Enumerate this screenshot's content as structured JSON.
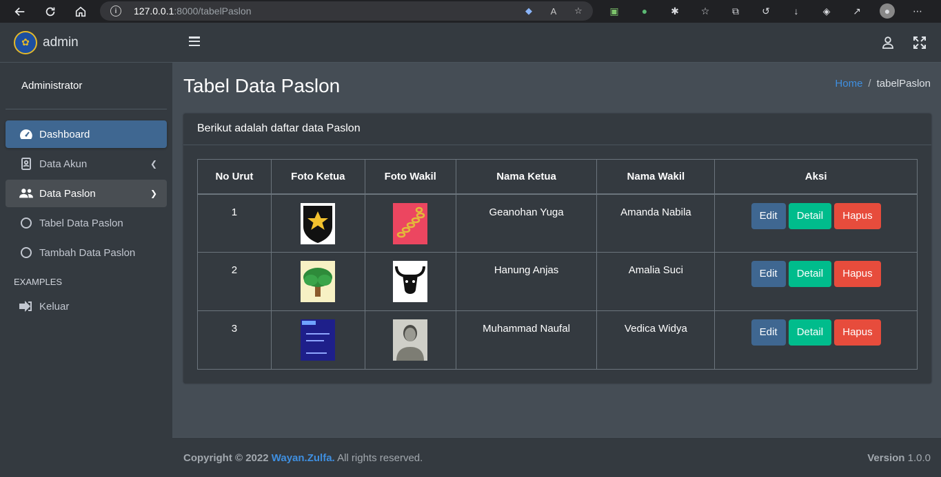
{
  "browser": {
    "url_host": "127.0.0.1",
    "url_rest": ":8000/tabelPaslon"
  },
  "sidebar": {
    "brand": "admin",
    "user": "Administrator",
    "items": [
      {
        "label": "Dashboard",
        "icon": "tachometer-icon"
      },
      {
        "label": "Data Akun",
        "icon": "address-book-icon"
      },
      {
        "label": "Data Paslon",
        "icon": "users-icon"
      },
      {
        "label": "Tabel Data Paslon",
        "icon": "circle-icon"
      },
      {
        "label": "Tambah Data Paslon",
        "icon": "circle-icon"
      }
    ],
    "header": "EXAMPLES",
    "logout": "Keluar"
  },
  "page": {
    "title": "Tabel Data Paslon",
    "breadcrumb_home": "Home",
    "breadcrumb_sep": "/",
    "breadcrumb_current": "tabelPaslon"
  },
  "card": {
    "header": "Berikut adalah daftar data Paslon",
    "columns": [
      "No Urut",
      "Foto Ketua",
      "Foto Wakil",
      "Nama Ketua",
      "Nama Wakil",
      "Aksi"
    ],
    "rows": [
      {
        "no": "1",
        "ketua": "Geanohan Yuga",
        "wakil": "Amanda Nabila"
      },
      {
        "no": "2",
        "ketua": "Hanung Anjas",
        "wakil": "Amalia Suci"
      },
      {
        "no": "3",
        "ketua": "Muhammad Naufal",
        "wakil": "Vedica Widya"
      }
    ],
    "btn_edit": "Edit",
    "btn_detail": "Detail",
    "btn_hapus": "Hapus"
  },
  "footer": {
    "copyright": "Copyright © 2022",
    "author": "Wayan.Zulfa.",
    "rights": "All rights reserved.",
    "version_label": "Version",
    "version": "1.0.0"
  },
  "colors": {
    "accent": "#3f6791",
    "success": "#00bc8c",
    "danger": "#e74c3c",
    "link": "#3f8fe0"
  }
}
